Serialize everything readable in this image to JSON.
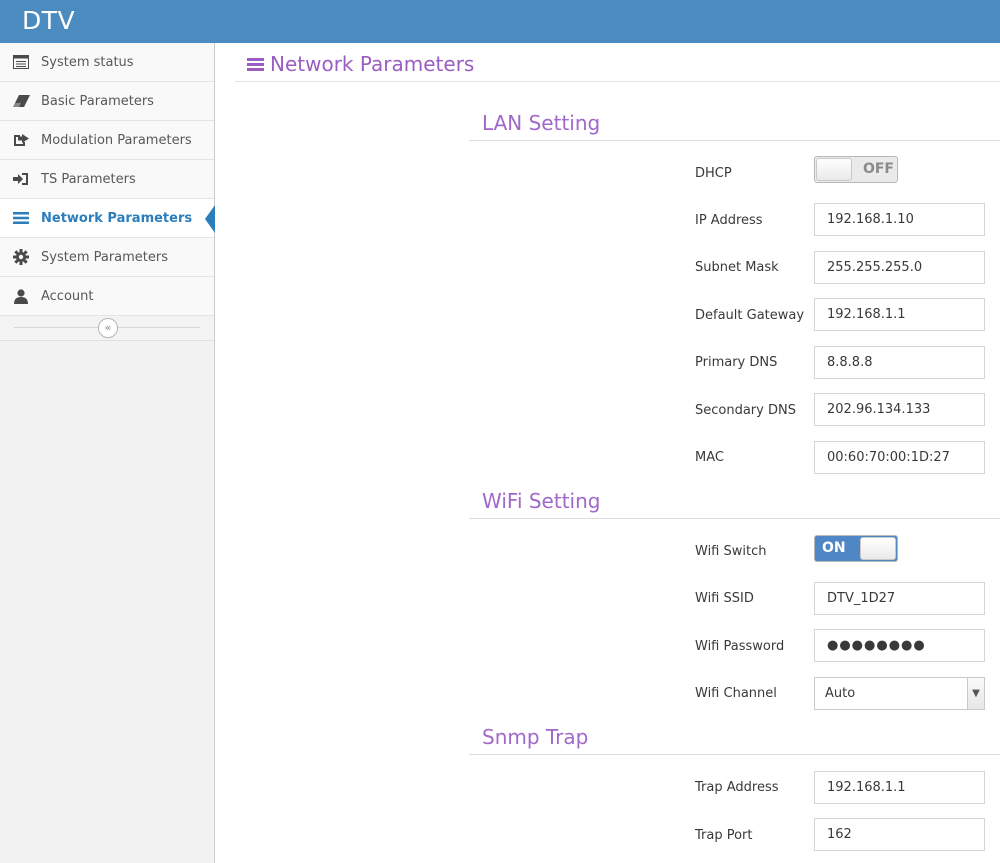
{
  "app": {
    "brand": "DTV"
  },
  "sidebar": {
    "items": [
      {
        "label": "System status",
        "icon": "list-icon"
      },
      {
        "label": "Basic Parameters",
        "icon": "eraser-icon"
      },
      {
        "label": "Modulation Parameters",
        "icon": "share-square-icon"
      },
      {
        "label": "TS Parameters",
        "icon": "sign-in-icon"
      },
      {
        "label": "Network Parameters",
        "icon": "menu-icon",
        "active": true
      },
      {
        "label": "System Parameters",
        "icon": "gear-icon"
      },
      {
        "label": "Account",
        "icon": "user-icon"
      }
    ],
    "collapse_glyph": "«"
  },
  "page": {
    "title": "Network Parameters"
  },
  "lan": {
    "title": "LAN Setting",
    "dhcp_label": "DHCP",
    "dhcp_state": "OFF",
    "ip_label": "IP Address",
    "ip_value": "192.168.1.10",
    "mask_label": "Subnet Mask",
    "mask_value": "255.255.255.0",
    "gateway_label": "Default Gateway",
    "gateway_value": "192.168.1.1",
    "dns1_label": "Primary DNS",
    "dns1_value": "8.8.8.8",
    "dns2_label": "Secondary DNS",
    "dns2_value": "202.96.134.133",
    "mac_label": "MAC",
    "mac_value": "00:60:70:00:1D:27"
  },
  "wifi": {
    "title": "WiFi Setting",
    "switch_label": "Wifi Switch",
    "switch_state": "ON",
    "ssid_label": "Wifi SSID",
    "ssid_value": "DTV_1D27",
    "password_label": "Wifi Password",
    "password_value": "●●●●●●●●",
    "channel_label": "Wifi Channel",
    "channel_value": "Auto"
  },
  "snmp": {
    "title": "Snmp Trap",
    "address_label": "Trap Address",
    "address_value": "192.168.1.1",
    "port_label": "Trap Port",
    "port_value": "162"
  },
  "colors": {
    "topbar": "#4c8bbf",
    "accent_purple": "#9a5dc2",
    "active_blue": "#2b7dbc",
    "toggle_on": "#4f86c6"
  }
}
